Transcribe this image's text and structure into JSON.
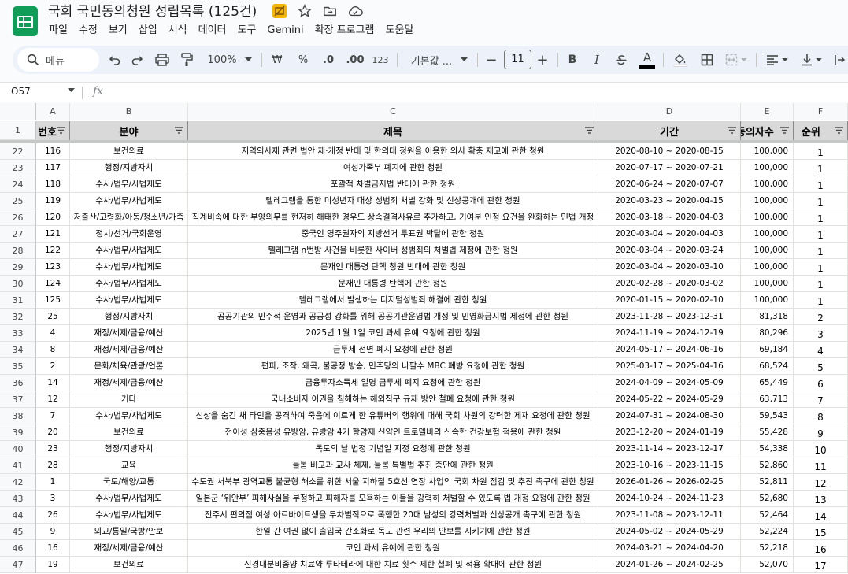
{
  "window": {
    "doc_title": "국회 국민동의청원 성립목록 (125건)"
  },
  "title_icons": [
    "folder-person-icon",
    "star-icon",
    "move-to-folder-icon",
    "cloud-saved-icon"
  ],
  "menu": [
    "파일",
    "수정",
    "보기",
    "삽입",
    "서식",
    "데이터",
    "도구",
    "Gemini",
    "확장 프로그램",
    "도움말"
  ],
  "toolbar": {
    "search_label": "메뉴",
    "zoom": "100%",
    "currency": "₩",
    "percent": "%",
    "dec_decrease": ".0",
    "dec_increase": ".00",
    "number_format": "123",
    "font": "기본값 ...",
    "font_size": "11",
    "minus": "−",
    "plus": "+",
    "bold": "B",
    "italic": "I",
    "text_color": "A"
  },
  "formula_bar": {
    "cell_ref": "O57",
    "fx": "fx"
  },
  "columns": [
    "A",
    "B",
    "C",
    "D",
    "E",
    "F"
  ],
  "header_row": {
    "row_num": "1",
    "cells": [
      "번호",
      "분야",
      "제목",
      "기간",
      "동의자수",
      "순위"
    ]
  },
  "rows": [
    {
      "r": "22",
      "no": "116",
      "field": "보건의료",
      "title": "지역의사제 관련 법안 제·개정 반대 및 한의대 정원을 이용한 의사 확충 재고에 관한 청원",
      "period": "2020-08-10 ~ 2020-08-15",
      "count": "100,000",
      "rank": "1"
    },
    {
      "r": "23",
      "no": "117",
      "field": "행정/지방자치",
      "title": "여성가족부 폐지에 관한 청원",
      "period": "2020-07-17 ~ 2020-07-21",
      "count": "100,000",
      "rank": "1"
    },
    {
      "r": "24",
      "no": "118",
      "field": "수사/법무/사법제도",
      "title": "포괄적 차별금지법 반대에 관한 청원",
      "period": "2020-06-24 ~ 2020-07-07",
      "count": "100,000",
      "rank": "1"
    },
    {
      "r": "25",
      "no": "119",
      "field": "수사/법무/사법제도",
      "title": "텔레그램을 통한 미성년자 대상 성범죄 처벌 강화 및 신상공개에 관한 청원",
      "period": "2020-03-23 ~ 2020-04-15",
      "count": "100,000",
      "rank": "1"
    },
    {
      "r": "26",
      "no": "120",
      "field": "저출산/고령화/아동/청소년/가족",
      "title": "직계비속에 대한 부양의무를 현저히 해태한 경우도 상속결격사유로 추가하고, 기여분 인정 요건을 완화하는 민법 개정",
      "period": "2020-03-18 ~ 2020-04-03",
      "count": "100,000",
      "rank": "1"
    },
    {
      "r": "27",
      "no": "121",
      "field": "정치/선거/국회운영",
      "title": "중국인 영주권자의 지방선거 투표권 박탈에 관한 청원",
      "period": "2020-03-04 ~ 2020-04-03",
      "count": "100,000",
      "rank": "1"
    },
    {
      "r": "28",
      "no": "122",
      "field": "수사/법무/사법제도",
      "title": "텔레그램 n번방 사건을 비롯한 사이버 성범죄의 처벌법 제정에 관한 청원",
      "period": "2020-03-04 ~ 2020-03-24",
      "count": "100,000",
      "rank": "1"
    },
    {
      "r": "29",
      "no": "123",
      "field": "수사/법무/사법제도",
      "title": "문재인 대통령 탄핵 청원 반대에 관한 청원",
      "period": "2020-03-04 ~ 2020-03-10",
      "count": "100,000",
      "rank": "1"
    },
    {
      "r": "30",
      "no": "124",
      "field": "수사/법무/사법제도",
      "title": "문재인 대통령 탄핵에 관한 청원",
      "period": "2020-02-28 ~ 2020-03-02",
      "count": "100,000",
      "rank": "1"
    },
    {
      "r": "31",
      "no": "125",
      "field": "수사/법무/사법제도",
      "title": "텔레그램에서 발생하는 디지털성범죄 해결에 관한 청원",
      "period": "2020-01-15 ~ 2020-02-10",
      "count": "100,000",
      "rank": "1"
    },
    {
      "r": "32",
      "no": "25",
      "field": "행정/지방자치",
      "title": "공공기관의 민주적 운영과 공공성 강화를 위해 공공기관운영법 개정 및 민영화금지법 제정에 관한 청원",
      "period": "2023-11-28 ~ 2023-12-31",
      "count": "81,318",
      "rank": "2"
    },
    {
      "r": "33",
      "no": "4",
      "field": "재정/세제/금융/예산",
      "title": "2025년 1월 1일 코인 과세 유예 요청에 관한 청원",
      "period": "2024-11-19 ~ 2024-12-19",
      "count": "80,296",
      "rank": "3"
    },
    {
      "r": "34",
      "no": "8",
      "field": "재정/세제/금융/예산",
      "title": "금투세 전면 폐지 요청에 관한 청원",
      "period": "2024-05-17 ~ 2024-06-16",
      "count": "69,184",
      "rank": "4"
    },
    {
      "r": "35",
      "no": "2",
      "field": "문화/체육/관광/언론",
      "title": "편파, 조작, 왜곡, 불공정 방송, 민주당의 나팔수 MBC 폐방 요청에 관한 청원",
      "period": "2025-03-17 ~ 2025-04-16",
      "count": "68,524",
      "rank": "5"
    },
    {
      "r": "36",
      "no": "14",
      "field": "재정/세제/금융/예산",
      "title": "금융투자소득세 일명 금투세 폐지 요청에 관한 청원",
      "period": "2024-04-09 ~ 2024-05-09",
      "count": "65,449",
      "rank": "6"
    },
    {
      "r": "37",
      "no": "12",
      "field": "기타",
      "title": "국내소비자 이권을 침해하는 해외직구 규제 방안 철폐 요청에 관한 청원",
      "period": "2024-05-22 ~ 2024-05-29",
      "count": "63,713",
      "rank": "7"
    },
    {
      "r": "38",
      "no": "7",
      "field": "수사/법무/사법제도",
      "title": "신상을 숨긴 채 타인을 공격하여 죽음에 이르게 한 유튜버의 행위에 대해 국회 차원의 강력한 제재 요청에 관한 청원",
      "period": "2024-07-31 ~ 2024-08-30",
      "count": "59,543",
      "rank": "8"
    },
    {
      "r": "39",
      "no": "20",
      "field": "보건의료",
      "title": "전이성 삼중음성 유방암, 유방암 4기 항암제 신약인 트로델비의 신속한 건강보험 적용에 관한 청원",
      "period": "2023-12-20 ~ 2024-01-19",
      "count": "55,428",
      "rank": "9"
    },
    {
      "r": "40",
      "no": "23",
      "field": "행정/지방자치",
      "title": "독도의 날 법정 기념일 지정 요청에 관한 청원",
      "period": "2023-11-14 ~ 2023-12-17",
      "count": "54,338",
      "rank": "10"
    },
    {
      "r": "41",
      "no": "28",
      "field": "교육",
      "title": "늘봄 비교과 교사 체제, 늘봄 특별법 추진 중단에 관한 청원",
      "period": "2023-10-16 ~ 2023-11-15",
      "count": "52,860",
      "rank": "11"
    },
    {
      "r": "42",
      "no": "1",
      "field": "국토/해양/교통",
      "title": "수도권 서북부 광역교통 불균형 해소를 위한 서울 지하철 5호선 연장 사업의 국회 차원 점검 및 추진 촉구에 관한 청원",
      "period": "2026-01-26 ~ 2026-02-25",
      "count": "52,811",
      "rank": "12"
    },
    {
      "r": "43",
      "no": "3",
      "field": "수사/법무/사법제도",
      "title": "일본군 ‘위안부’ 피해사실을 부정하고 피해자를 모욕하는 이들을 강력히 처벌할 수 있도록 법 개정 요청에 관한 청원",
      "period": "2024-10-24 ~ 2024-11-23",
      "count": "52,680",
      "rank": "13"
    },
    {
      "r": "44",
      "no": "26",
      "field": "수사/법무/사법제도",
      "title": "진주시 편의점 여성 아르바이트생을 무차별적으로 폭행한 20대 남성의 강력처벌과 신상공개 촉구에 관한 청원",
      "period": "2023-11-08 ~ 2023-12-11",
      "count": "52,464",
      "rank": "14"
    },
    {
      "r": "45",
      "no": "9",
      "field": "외교/통일/국방/안보",
      "title": "한일 간 여권 없이 출입국 간소화로 독도 관련 우리의 안보를 지키기에 관한 청원",
      "period": "2024-05-02 ~ 2024-05-29",
      "count": "52,224",
      "rank": "15"
    },
    {
      "r": "46",
      "no": "16",
      "field": "재정/세제/금융/예산",
      "title": "코인 과세 유예에 관한 청원",
      "period": "2024-03-21 ~ 2024-04-20",
      "count": "52,218",
      "rank": "16"
    },
    {
      "r": "47",
      "no": "19",
      "field": "보건의료",
      "title": "신경내분비종양 치료약 루타테라에 대한 치료 횟수 제한 철폐 및 적용 확대에 관한 청원",
      "period": "2024-01-26 ~ 2024-02-25",
      "count": "52,070",
      "rank": "17"
    }
  ]
}
